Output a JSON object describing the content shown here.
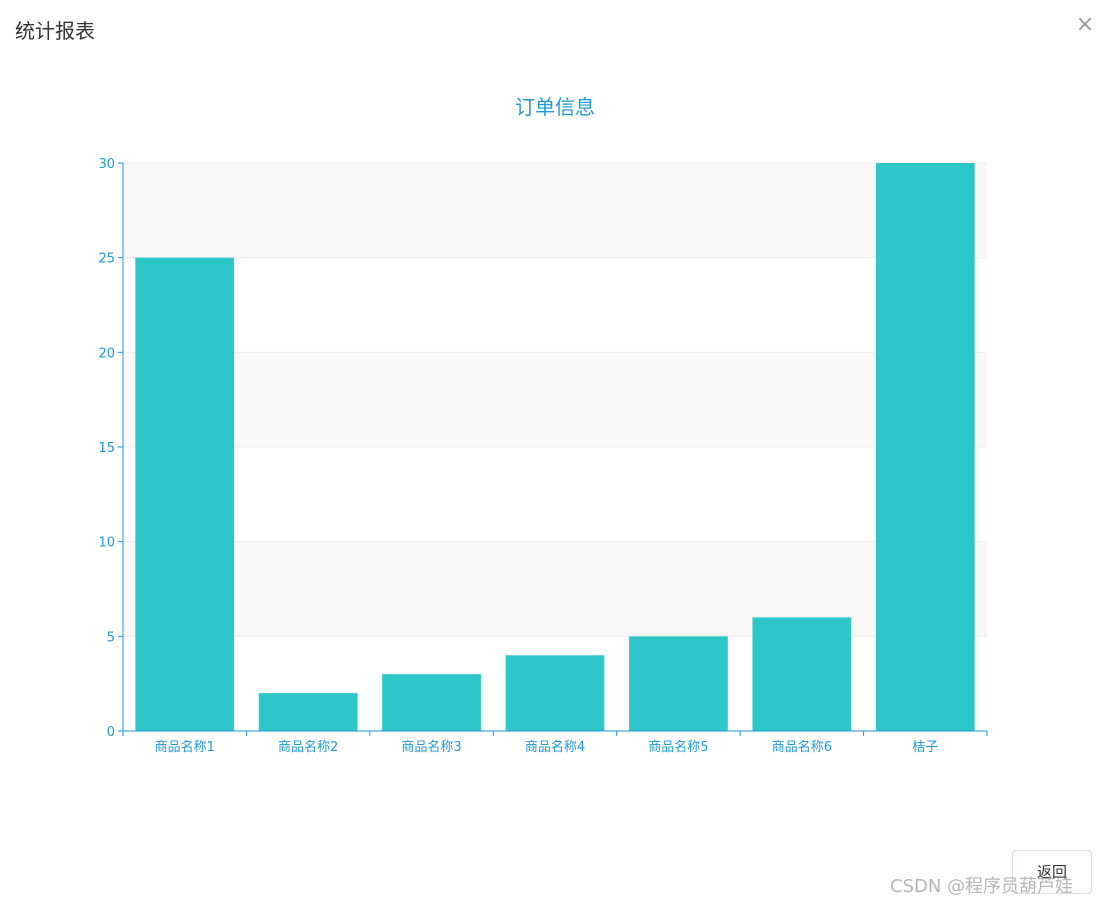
{
  "dialog": {
    "title": "统计报表",
    "close_icon": "close-icon",
    "close_glyph": "×",
    "back_label": "返回"
  },
  "watermark": "CSDN @程序员葫芦娃",
  "colors": {
    "bar": "#2ec7c9",
    "axis": "#1f9ad6",
    "band": "#f8f8f8"
  },
  "chart_data": {
    "type": "bar",
    "title": "订单信息",
    "categories": [
      "商品名称1",
      "商品名称2",
      "商品名称3",
      "商品名称4",
      "商品名称5",
      "商品名称6",
      "桔子"
    ],
    "values": [
      25,
      2,
      3,
      4,
      5,
      6,
      30
    ],
    "ylim": [
      0,
      30
    ],
    "yticks": [
      0,
      5,
      10,
      15,
      20,
      25,
      30
    ],
    "grid": true,
    "xlabel": "",
    "ylabel": ""
  }
}
